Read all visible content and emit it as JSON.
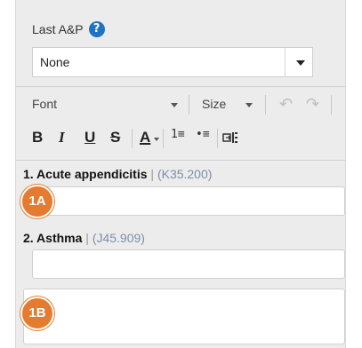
{
  "last_ap": {
    "label": "Last A&P",
    "help_icon": "?",
    "selected": "None"
  },
  "toolbar": {
    "font_label": "Font",
    "size_label": "Size",
    "bold": "B",
    "italic": "I",
    "underline": "U",
    "strikethrough": "S",
    "font_color": "A",
    "icons": [
      "undo-icon",
      "redo-icon",
      "numbered-list-icon",
      "bulleted-list-icon",
      "insert-template-icon"
    ]
  },
  "diagnoses": [
    {
      "label": "1. Acute appendicitis",
      "separator": "|",
      "code": "(K35.200)"
    },
    {
      "label": "2. Asthma",
      "separator": "|",
      "code": "(J45.909)"
    }
  ],
  "badges": {
    "a": "1A",
    "b": "1B"
  },
  "colors": {
    "badge": "#e57b2e",
    "help": "#1e73c4",
    "panel": "#ececec"
  }
}
